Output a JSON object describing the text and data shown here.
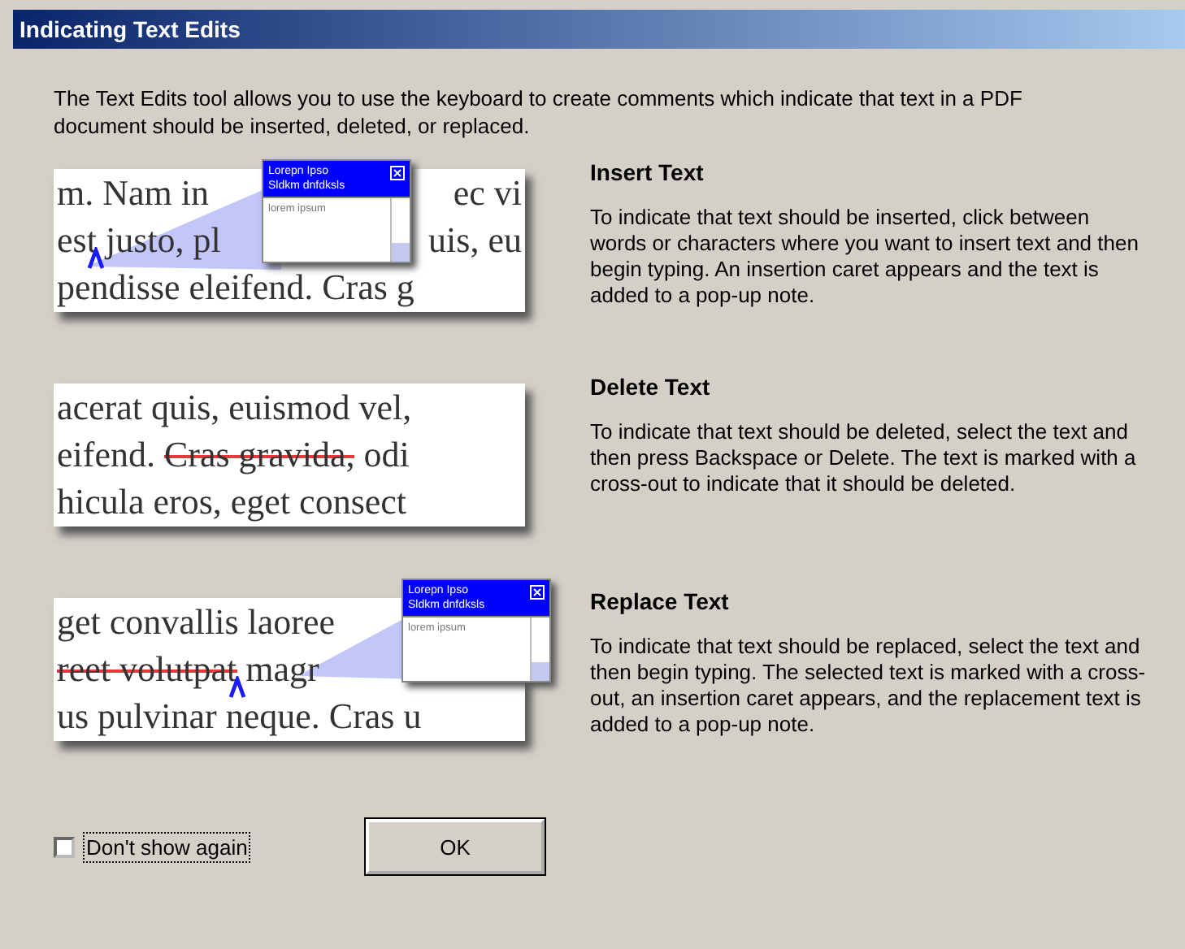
{
  "window": {
    "title": "Indicating Text Edits"
  },
  "intro": "The Text Edits tool allows you to use the keyboard to create comments which indicate that text in a PDF document should be inserted, deleted, or replaced.",
  "sections": [
    {
      "title": "Insert Text",
      "description": "To indicate that text should be inserted, click between words or characters where you want to insert text and then begin typing.  An insertion caret appears and the text is added to a pop-up note.",
      "illustration": {
        "lines": [
          {
            "segments": [
              {
                "kind": "text",
                "text": "m. Nam in"
              }
            ],
            "end": "ec vi"
          },
          {
            "segments": [
              {
                "kind": "text",
                "text": "est"
              },
              {
                "kind": "caret"
              },
              {
                "kind": "text",
                "text": " justo, pl"
              }
            ],
            "end": "uis, eu"
          },
          {
            "segments": [
              {
                "kind": "text",
                "text": "pendisse eleifend. Cras g"
              }
            ]
          }
        ],
        "popup": {
          "title": "Lorepn Ipso",
          "subtitle": "Sldkm dnfdksls",
          "body": "lorem ipsum"
        }
      }
    },
    {
      "title": "Delete Text",
      "description": "To indicate that text should be deleted, select the text and then press Backspace or Delete. The text is marked with a cross-out to indicate that it should be deleted.",
      "illustration": {
        "lines": [
          {
            "segments": [
              {
                "kind": "text",
                "text": "acerat quis, euismod vel,"
              }
            ]
          },
          {
            "segments": [
              {
                "kind": "text",
                "text": "eifend. "
              },
              {
                "kind": "struck",
                "text": "Cras gravida,"
              },
              {
                "kind": "text",
                "text": " odi"
              }
            ]
          },
          {
            "segments": [
              {
                "kind": "text",
                "text": "hicula eros, eget consect"
              }
            ]
          }
        ]
      }
    },
    {
      "title": "Replace Text",
      "description": "To indicate that text should be replaced, select the text and then begin typing.  The selected text is marked with a cross-out, an insertion caret appears, and the replacement text is added to a pop-up note.",
      "illustration": {
        "lines": [
          {
            "segments": [
              {
                "kind": "text",
                "text": "get convallis laoree"
              }
            ]
          },
          {
            "segments": [
              {
                "kind": "struck",
                "text": "reet volutpat"
              },
              {
                "kind": "caret"
              },
              {
                "kind": "text",
                "text": " magr"
              }
            ]
          },
          {
            "segments": [
              {
                "kind": "text",
                "text": "us pulvinar neque. Cras u"
              }
            ]
          }
        ],
        "popup": {
          "title": "Lorepn Ipso",
          "subtitle": "Sldkm dnfdksls",
          "body": "lorem ipsum"
        }
      }
    }
  ],
  "dont_show": {
    "label": "Don't show again",
    "checked": false
  },
  "buttons": [
    "OK"
  ]
}
